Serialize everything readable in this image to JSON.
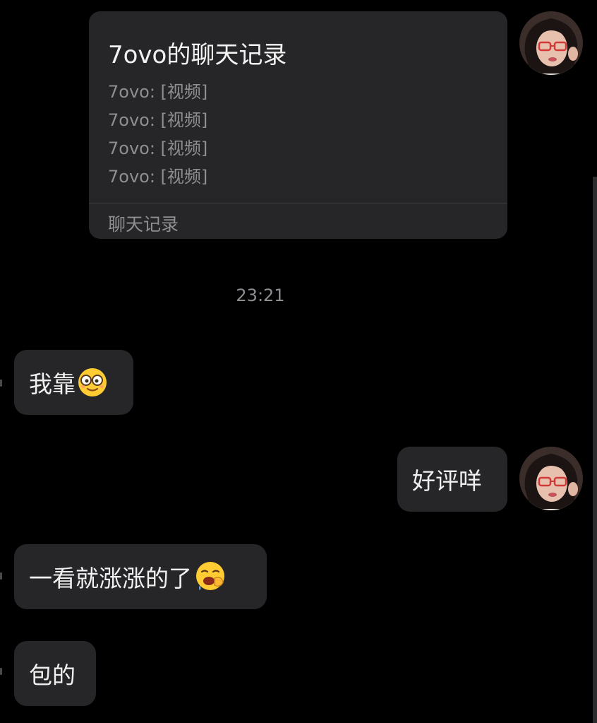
{
  "chat_record_card": {
    "title": "7ovo的聊天记录",
    "entries": [
      "7ovo: [视频]",
      "7ovo: [视频]",
      "7ovo: [视频]",
      "7ovo: [视频]"
    ],
    "footer_label": "聊天记录"
  },
  "timestamp": "23:21",
  "messages": [
    {
      "side": "left",
      "text": "我靠",
      "emoji": "smiling-face-with-glasses-emoji"
    },
    {
      "side": "right",
      "text": "好评咩"
    },
    {
      "side": "left",
      "text": "一看就涨涨的了",
      "emoji": "yawning-face-emoji"
    },
    {
      "side": "left",
      "text": "包的"
    }
  ],
  "icons": {
    "own_avatar": "user-avatar-photo"
  },
  "colors": {
    "background": "#000000",
    "bubble": "#262628",
    "secondary_text": "#8e8e93"
  }
}
